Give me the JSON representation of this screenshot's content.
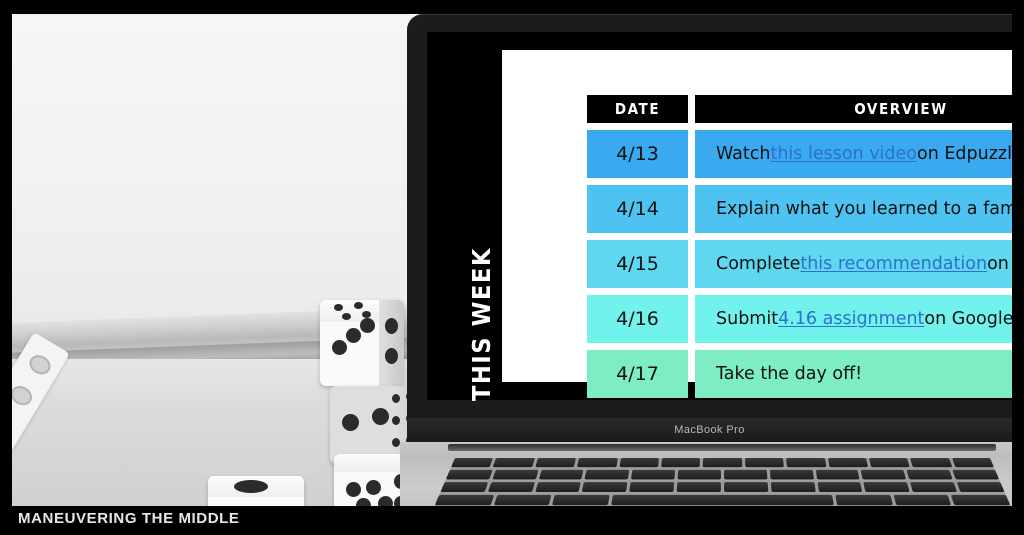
{
  "brand": {
    "watermark": "MANEUVERING THE MIDDLE",
    "laptop_label": "MacBook Pro"
  },
  "screen": {
    "side_label": "THIS WEEK"
  },
  "table": {
    "headers": {
      "date": "DATE",
      "overview": "OVERVIEW"
    },
    "header_bg": "#000000",
    "header_text_color": "#ffffff",
    "link_color": "#2f6fd0",
    "rows": [
      {
        "date": "4/13",
        "bg": "#3aaaf0",
        "overview_prefix": "Watch ",
        "overview_link": "this lesson video",
        "overview_suffix": " on Edpuzzle."
      },
      {
        "date": "4/14",
        "bg": "#4ec2f0",
        "overview_prefix": "Explain what you learned to a family member.",
        "overview_link": "",
        "overview_suffix": ""
      },
      {
        "date": "4/15",
        "bg": "#5fd7ee",
        "overview_prefix": "Complete ",
        "overview_link": "this recommendation",
        "overview_suffix": " on Khan."
      },
      {
        "date": "4/16",
        "bg": "#72f2ec",
        "overview_prefix": "Submit ",
        "overview_link": "4.16 assignment",
        "overview_suffix": " on Google Classroom."
      },
      {
        "date": "4/17",
        "bg": "#7eedc4",
        "overview_prefix": "Take the day off!",
        "overview_link": "",
        "overview_suffix": ""
      }
    ]
  }
}
